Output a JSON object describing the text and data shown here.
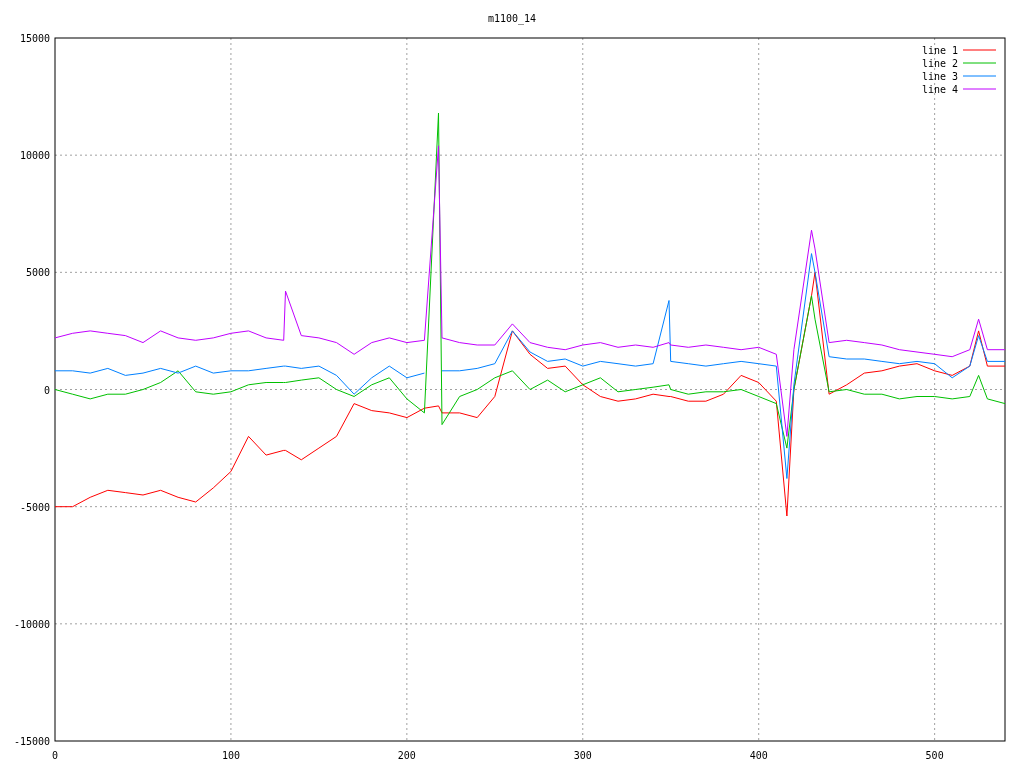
{
  "chart": {
    "chart_data": {
      "type": "line",
      "title": "m1100_14",
      "grid": true,
      "legend": "upper right",
      "xlim": [
        0,
        540
      ],
      "ylim": [
        -15000,
        15000
      ],
      "xticks": [
        0,
        100,
        200,
        300,
        400,
        500
      ],
      "yticks": [
        -15000,
        -10000,
        -5000,
        0,
        5000,
        10000,
        15000
      ],
      "x": [
        0,
        10,
        20,
        30,
        40,
        50,
        60,
        70,
        80,
        90,
        100,
        110,
        120,
        130,
        131,
        140,
        150,
        160,
        170,
        180,
        190,
        200,
        210,
        218,
        220,
        230,
        240,
        250,
        260,
        270,
        280,
        290,
        300,
        310,
        320,
        330,
        340,
        349,
        350,
        360,
        370,
        380,
        390,
        400,
        410,
        416,
        420,
        430,
        432,
        440,
        450,
        460,
        470,
        480,
        490,
        500,
        510,
        520,
        525,
        530,
        540
      ],
      "series": [
        {
          "name": "line 1",
          "color": "#ff0000",
          "values": [
            -5000,
            -5000,
            -4600,
            -4300,
            -4400,
            -4500,
            -4300,
            -4600,
            -4800,
            -4200,
            -3500,
            -2000,
            -2800,
            -2600,
            -2600,
            -3000,
            -2500,
            -2000,
            -600,
            -900,
            -1000,
            -1200,
            -800,
            -700,
            -1000,
            -1000,
            -1200,
            -300,
            2500,
            1500,
            900,
            1000,
            200,
            -300,
            -500,
            -400,
            -200,
            -300,
            -300,
            -500,
            -500,
            -200,
            600,
            300,
            -500,
            -5400,
            0,
            4000,
            5000,
            -200,
            200,
            700,
            800,
            1000,
            1100,
            800,
            600,
            1000,
            2500,
            1000,
            1000
          ]
        },
        {
          "name": "line 2",
          "color": "#00c000",
          "values": [
            0,
            -200,
            -400,
            -200,
            -200,
            0,
            300,
            800,
            -100,
            -200,
            -100,
            200,
            300,
            300,
            300,
            400,
            500,
            0,
            -300,
            200,
            500,
            -400,
            -1000,
            11800,
            -1500,
            -300,
            0,
            500,
            800,
            0,
            400,
            -100,
            200,
            500,
            -100,
            0,
            100,
            200,
            0,
            -200,
            -100,
            -100,
            0,
            -300,
            -600,
            -2500,
            0,
            4000,
            3000,
            -100,
            0,
            -200,
            -200,
            -400,
            -300,
            -300,
            -400,
            -300,
            600,
            -400,
            -600
          ]
        },
        {
          "name": "line 3",
          "color": "#0080ff",
          "values": [
            800,
            800,
            700,
            900,
            600,
            700,
            900,
            700,
            1000,
            700,
            800,
            800,
            900,
            1000,
            1000,
            900,
            1000,
            600,
            -200,
            500,
            1000,
            500,
            700,
            null,
            800,
            800,
            900,
            1100,
            2500,
            1600,
            1200,
            1300,
            1000,
            1200,
            1100,
            1000,
            1100,
            3800,
            1200,
            1100,
            1000,
            1100,
            1200,
            1100,
            1000,
            -3800,
            200,
            5800,
            5000,
            1400,
            1300,
            1300,
            1200,
            1100,
            1200,
            1100,
            500,
            1000,
            2300,
            1200,
            1200
          ]
        },
        {
          "name": "line 4",
          "color": "#c000ff",
          "values": [
            2200,
            2400,
            2500,
            2400,
            2300,
            2000,
            2500,
            2200,
            2100,
            2200,
            2400,
            2500,
            2200,
            2100,
            4200,
            2300,
            2200,
            2000,
            1500,
            2000,
            2200,
            2000,
            2100,
            10400,
            2200,
            2000,
            1900,
            1900,
            2800,
            2000,
            1800,
            1700,
            1900,
            2000,
            1800,
            1900,
            1800,
            2000,
            1900,
            1800,
            1900,
            1800,
            1700,
            1800,
            1500,
            -2000,
            1700,
            6800,
            6000,
            2000,
            2100,
            2000,
            1900,
            1700,
            1600,
            1500,
            1400,
            1700,
            3000,
            1700,
            1700
          ]
        }
      ]
    }
  }
}
